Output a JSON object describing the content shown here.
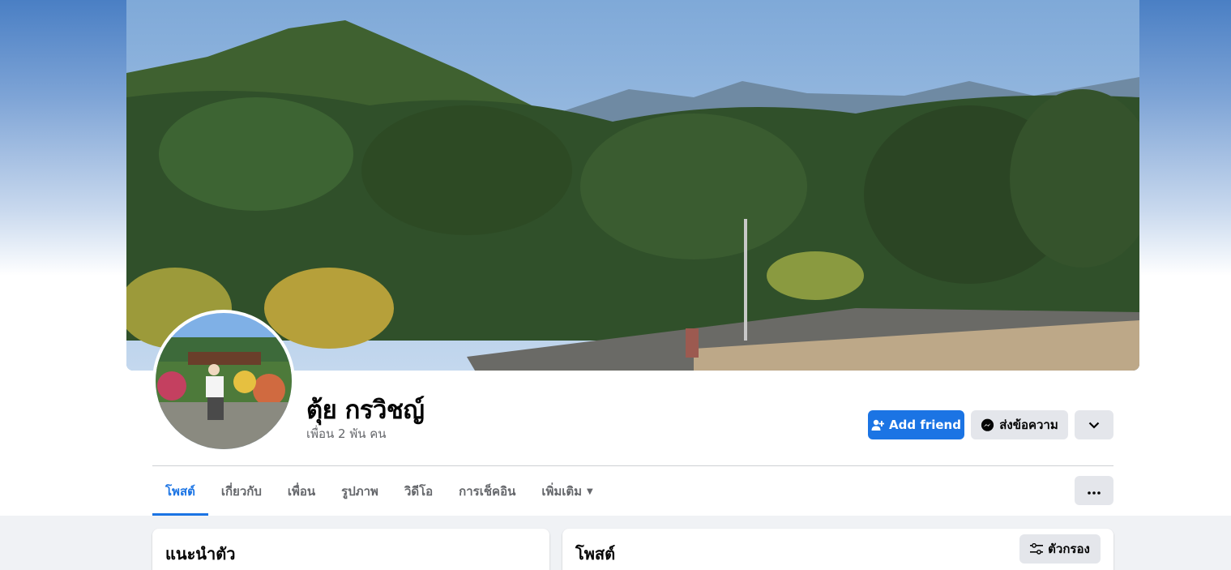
{
  "profile": {
    "name": "ตุ้ย กรวิชญ์",
    "friends_text": "เพื่อน 2 พัน คน"
  },
  "actions": {
    "add_friend_label": "Add friend",
    "message_label": "ส่งข้อความ"
  },
  "tabs": [
    {
      "label": "โพสต์",
      "active": true
    },
    {
      "label": "เกี่ยวกับ",
      "active": false
    },
    {
      "label": "เพื่อน",
      "active": false
    },
    {
      "label": "รูปภาพ",
      "active": false
    },
    {
      "label": "วิดีโอ",
      "active": false
    },
    {
      "label": "การเช็คอิน",
      "active": false
    },
    {
      "label": "เพิ่มเติม",
      "active": false
    }
  ],
  "intro": {
    "title": "แนะนำตัว"
  },
  "posts": {
    "title": "โพสต์",
    "filter_label": "ตัวกรอง"
  },
  "icons": {
    "add_friend": "person-plus-icon",
    "message": "messenger-icon",
    "chevron": "chevron-down-icon",
    "more": "ellipsis-icon",
    "filter": "sliders-icon",
    "tab_caret": "caret-down-icon"
  },
  "colors": {
    "accent": "#1b74e4",
    "secondary_button": "#e4e6eb",
    "muted_text": "#65676b",
    "page_background": "#f0f2f5"
  }
}
